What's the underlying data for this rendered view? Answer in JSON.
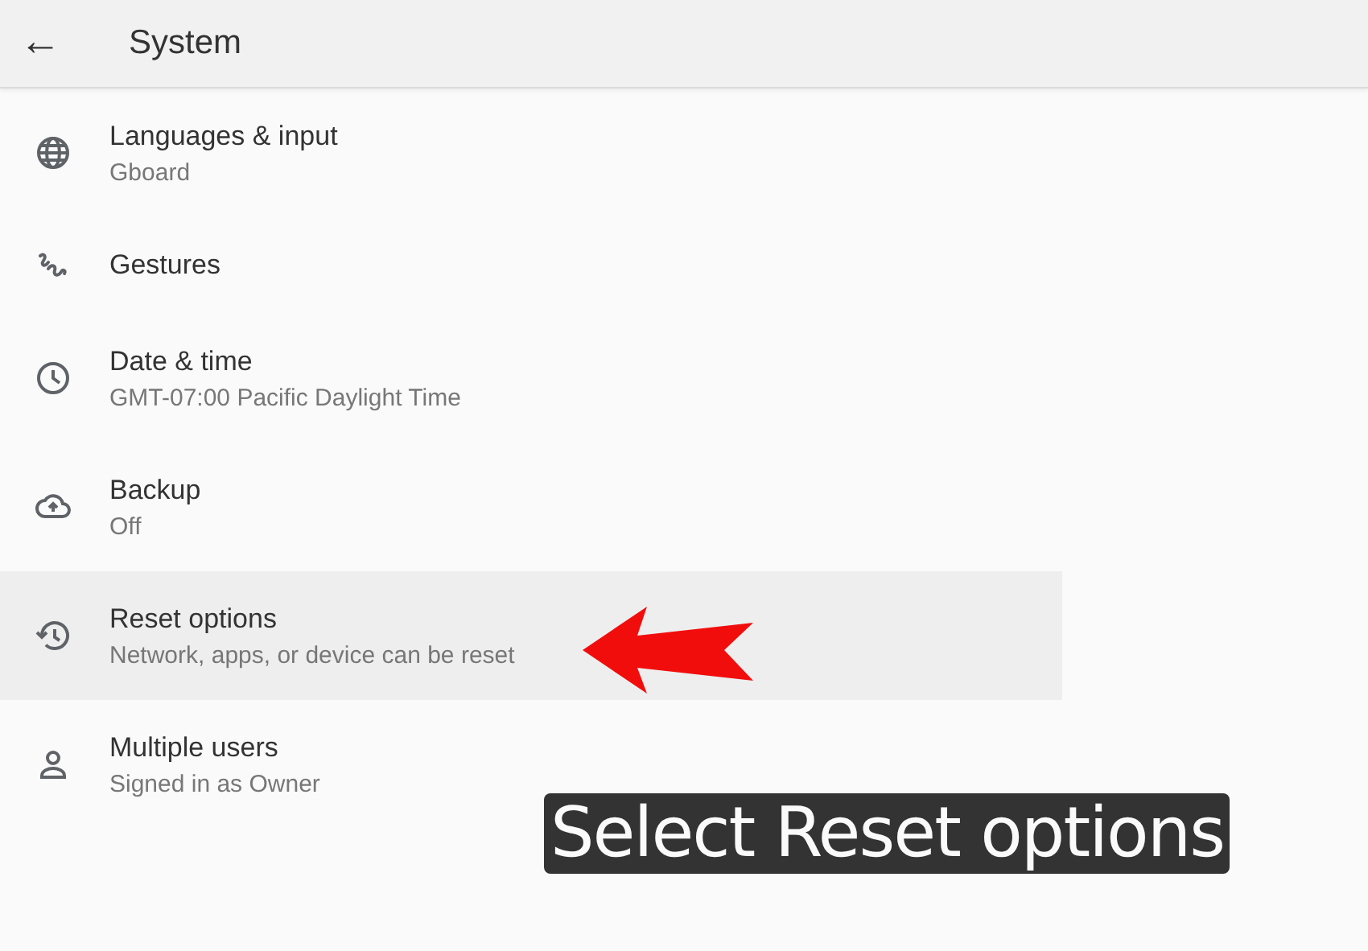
{
  "header": {
    "back": "←",
    "title": "System"
  },
  "items": [
    {
      "title": "Languages & input",
      "summary": "Gboard",
      "selected": false
    },
    {
      "title": "Gestures",
      "selected": false
    },
    {
      "title": "Date & time",
      "summary": "GMT-07:00 Pacific Daylight Time",
      "selected": false
    },
    {
      "title": "Backup",
      "summary": "Off",
      "selected": false
    },
    {
      "title": "Reset options",
      "summary": "Network, apps, or device can be reset",
      "selected": true
    },
    {
      "title": "Multiple users",
      "summary": "Signed in as Owner",
      "selected": false
    }
  ],
  "caption": "Select Reset options"
}
